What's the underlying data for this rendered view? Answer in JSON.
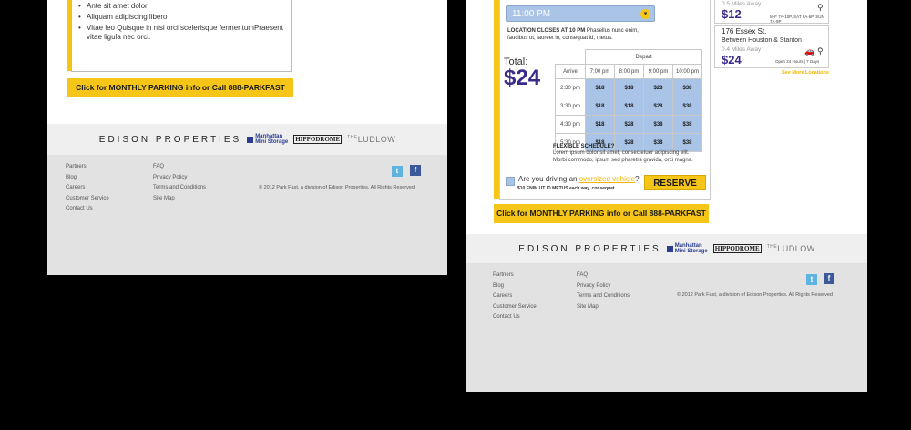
{
  "left": {
    "bullets": [
      "Ante sit amet dolor",
      "Aliquam adipiscing libero",
      "Vitae leo Quisque in nisi orci scelerisque fermentumPraesent vitae ligula nec orci."
    ],
    "cta_label": "Click for MONTHLY PARKING info or Call  888-PARKFAST"
  },
  "brand": {
    "name": "EDISON PROPERTIES",
    "logo1_line1": "Manhattan",
    "logo1_line2": "Mini Storage",
    "logo2": "HIPPODROME",
    "logo3_prefix": "THE",
    "logo3": "LUDLOW"
  },
  "footer": {
    "col1": [
      "Partners",
      "Blog",
      "Careers",
      "Customer Service",
      "Contact Us"
    ],
    "col2": [
      "FAQ",
      "Privacy Policy",
      "Terms and Conditions",
      "Site Map"
    ],
    "copyright": "© 2012 Park Fast, a division of Edison Properties. All Rights Reserved",
    "twitter_icon": "twitter-icon",
    "facebook_icon": "facebook-icon",
    "twitter_glyph": "t",
    "facebook_glyph": "f"
  },
  "reservation": {
    "time_value": "11:00 PM",
    "closes_bold": "LOCATION CLOSES AT 10 PM",
    "closes_text": "Phasellus nunc enim, faucibus ut, laoreet in, consequat id, metus.",
    "total_label": "Total:",
    "total_value": "$24",
    "table": {
      "depart_label": "Depart",
      "arrive_label": "Arrive",
      "depart_times": [
        "7:00 pm",
        "8:00 pm",
        "9:00 pm",
        "10:00 pm"
      ],
      "rows": [
        {
          "arrive": "2:30 pm",
          "prices": [
            "$18",
            "$18",
            "$28",
            "$38"
          ]
        },
        {
          "arrive": "3:30 pm",
          "prices": [
            "$18",
            "$18",
            "$28",
            "$38"
          ]
        },
        {
          "arrive": "4:30 pm",
          "prices": [
            "$18",
            "$28",
            "$38",
            "$38"
          ]
        },
        {
          "arrive": "5:30 pm",
          "prices": [
            "$18",
            "$28",
            "$38",
            "$38"
          ]
        }
      ]
    },
    "flex_title": "FLEXIBLE SCHEDULE?",
    "flex_text": "Lorem ipsum dolor sit amet, consectetuer adipiscing elit. Morbi commodo, ipsum sed pharetra gravida, orci magna.",
    "oversize_prefix": "Are you driving an ",
    "oversize_link": "oversized vehicle",
    "oversize_suffix": "?",
    "fee_note": "$10 ENIM UT ID METUS each way. consequat.",
    "reserve_label": "RESERVE",
    "cta_label": "Click for MONTHLY PARKING info or Call 888-PARKFAST"
  },
  "locations": [
    {
      "distance": "0.5 Miles Away",
      "price": "$12",
      "hours": "M-F 7A-10P, SAT 9A-6P, SUN 7A-9P",
      "icon": "bike-icon",
      "glyph": "⚲"
    },
    {
      "name": "176 Essex St.",
      "cross": "Between Houston & Stanton",
      "distance": "0.4 Miles Away",
      "price": "$24",
      "hours": "Open 24 Hours | 7 Days",
      "icon1": "car-icon",
      "icon2": "bike-icon",
      "glyph1": "🚗",
      "glyph2": "⚲"
    }
  ],
  "see_more": "See More Locations",
  "colors": {
    "accent": "#f5c518",
    "brand_purple": "#3b2a8a",
    "cell_blue": "#a9c4e6"
  }
}
